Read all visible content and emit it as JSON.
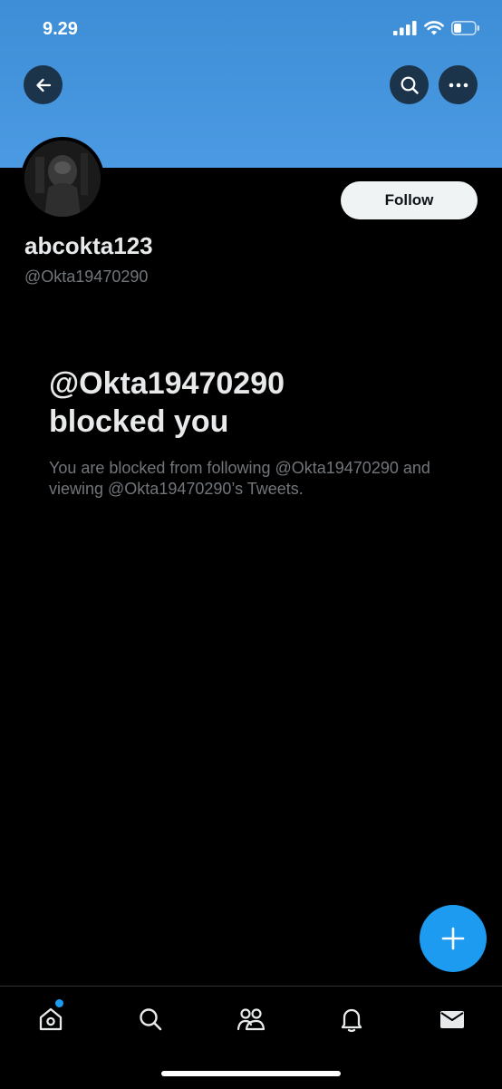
{
  "status_bar": {
    "time": "9.29",
    "icons": [
      "signal-icon",
      "wifi-icon",
      "battery-icon"
    ]
  },
  "header": {
    "back_icon": "back-arrow-icon",
    "search_icon": "search-icon",
    "more_icon": "more-icon"
  },
  "profile": {
    "display_name": "abcokta123",
    "handle": "@Okta19470290",
    "follow_label": "Follow"
  },
  "blocked": {
    "title_line1": "@Okta19470290",
    "title_line2": "blocked you",
    "description": "You are blocked from following @Okta19470290 and viewing @Okta19470290’s Tweets."
  },
  "fab": {
    "icon": "plus-icon"
  },
  "tabbar": {
    "items": [
      "home-icon",
      "search-icon",
      "communities-icon",
      "notifications-icon",
      "messages-icon"
    ]
  },
  "colors": {
    "accent": "#1d9bf0",
    "banner": "#4b9ae3",
    "background": "#000000",
    "secondary_text": "#71767b"
  }
}
